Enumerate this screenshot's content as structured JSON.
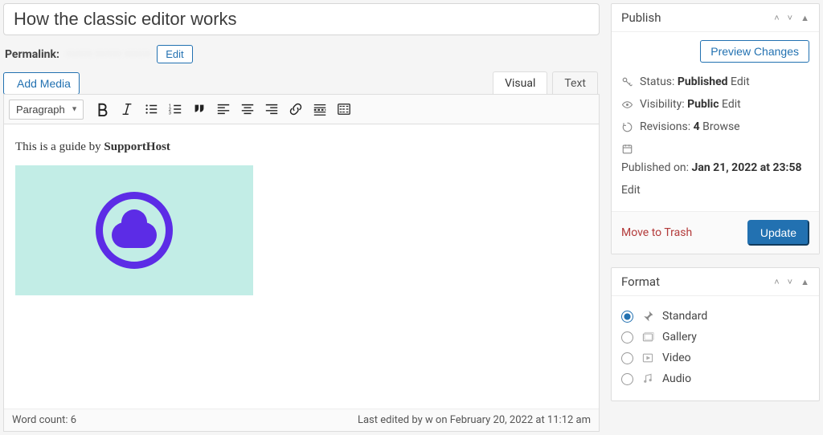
{
  "title": "How the classic editor works",
  "permalink": {
    "label": "Permalink:",
    "url": "——— ——— ———",
    "edit": "Edit"
  },
  "media": {
    "add_media": "Add Media"
  },
  "tabs": {
    "visual": "Visual",
    "text": "Text",
    "active": "visual"
  },
  "toolbar": {
    "format_select": "Paragraph"
  },
  "content": {
    "paragraph_prefix": "This is a guide by ",
    "paragraph_bold": "SupportHost"
  },
  "status_bar": {
    "word_count_label": "Word count: ",
    "word_count": "6",
    "last_edited": "Last edited by w on February 20, 2022 at 11:12 am"
  },
  "publish": {
    "panel_title": "Publish",
    "preview": "Preview Changes",
    "status_label": "Status: ",
    "status_value": "Published",
    "visibility_label": "Visibility: ",
    "visibility_value": "Public",
    "revisions_label": "Revisions: ",
    "revisions_value": "4",
    "browse": "Browse",
    "published_label": "Published on: ",
    "published_value": "Jan 21, 2022 at 23:58",
    "edit": "Edit",
    "trash": "Move to Trash",
    "update": "Update"
  },
  "format": {
    "panel_title": "Format",
    "options": [
      {
        "label": "Standard",
        "icon": "pin",
        "checked": true
      },
      {
        "label": "Gallery",
        "icon": "gallery",
        "checked": false
      },
      {
        "label": "Video",
        "icon": "video",
        "checked": false
      },
      {
        "label": "Audio",
        "icon": "audio",
        "checked": false
      }
    ]
  }
}
